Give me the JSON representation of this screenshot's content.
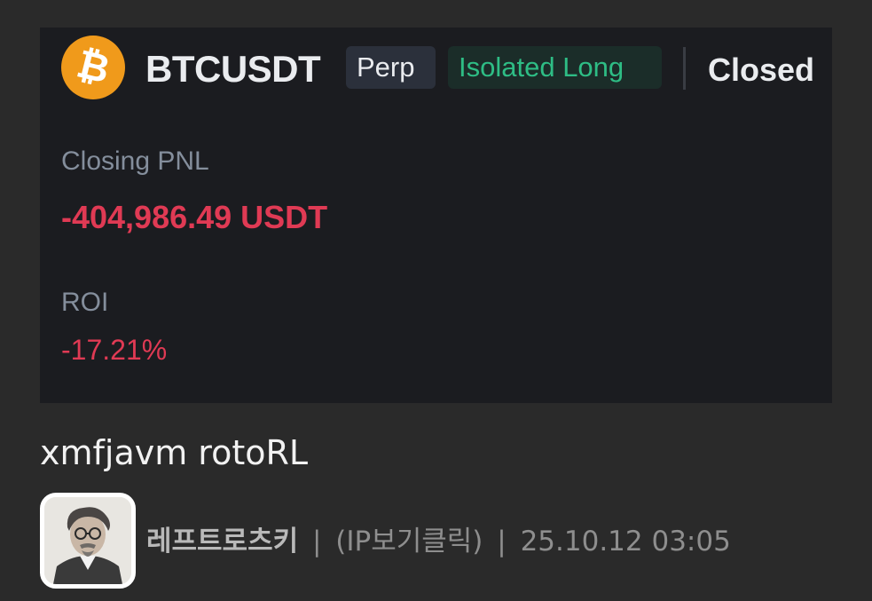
{
  "trade_card": {
    "coin_icon": "bitcoin-icon",
    "symbol": "BTCUSDT",
    "contract_type": "Perp",
    "margin_mode": "Isolated Long",
    "status": "Closed",
    "closing_pnl_label": "Closing PNL",
    "closing_pnl_value": "-404,986.49 USDT",
    "roi_label": "ROI",
    "roi_value": "-17.21%",
    "colors": {
      "coin": "#f09a1b",
      "loss": "#e03a54",
      "long": "#2ebd85",
      "card_bg": "#1b1c20"
    }
  },
  "post": {
    "caption": "xmfjavm rotoRL",
    "author_nickname": "레프트로츠키",
    "ip_toggle": "(IP보기클릭)",
    "timestamp": "25.10.12 03:05",
    "separator": "|",
    "avatar_icon": "user-avatar-photo"
  },
  "page": {
    "background": "#2a2a2a"
  }
}
